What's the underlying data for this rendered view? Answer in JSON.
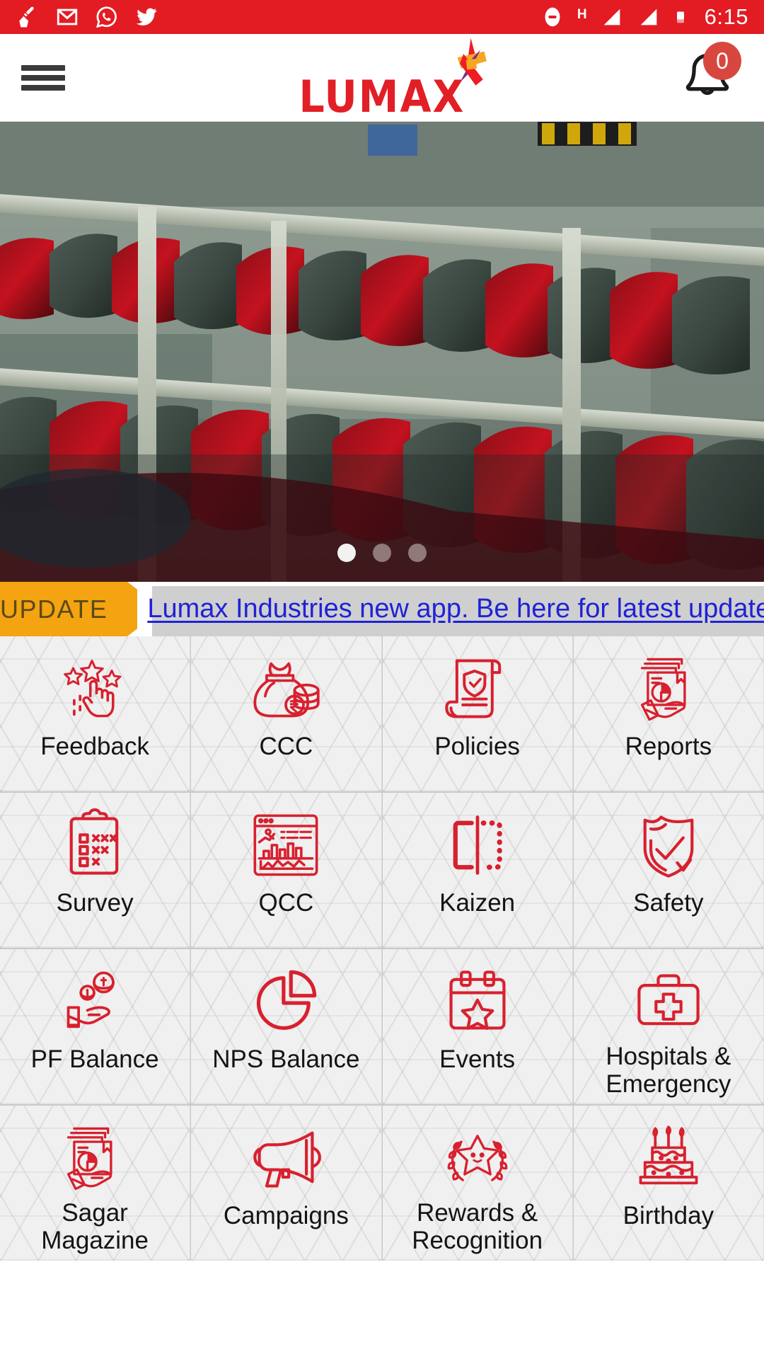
{
  "statusbar": {
    "time": "6:15",
    "network_type": "H",
    "left_icons": [
      "broom-cleaner-icon",
      "gmail-icon",
      "whatsapp-icon",
      "twitter-icon"
    ],
    "right_icons": [
      "do-not-disturb-icon",
      "signal-bars-icon",
      "signal-bars-2-icon",
      "battery-icon"
    ]
  },
  "header": {
    "menu_label": "menu",
    "brand_name": "LUMAX",
    "notification_count": "0"
  },
  "hero": {
    "caption": "",
    "slide_count": 3,
    "active_slide": 1
  },
  "ticker": {
    "tag_label": "UPDATE",
    "message": "Lumax Industries new app. Be here for latest updates."
  },
  "colors": {
    "brand_red": "#e21f26",
    "status_red": "#e31b23",
    "icon_red": "#d8202f",
    "update_orange": "#f4a311",
    "link_blue": "#1f22d6",
    "tile_bg": "#eff0ef",
    "ticker_grey": "#cfcfcf"
  },
  "grid": {
    "tiles": [
      {
        "label": "Feedback",
        "icon": "stars-hand-rating-icon"
      },
      {
        "label": "CCC",
        "icon": "money-bag-rupee-icon"
      },
      {
        "label": "Policies",
        "icon": "scroll-shield-check-icon"
      },
      {
        "label": "Reports",
        "icon": "documents-piechart-hand-icon"
      },
      {
        "label": "Survey",
        "icon": "clipboard-checklist-icon"
      },
      {
        "label": "QCC",
        "icon": "dashboard-charts-icon"
      },
      {
        "label": "Kaizen",
        "icon": "bracket-dotted-icon"
      },
      {
        "label": "Safety",
        "icon": "shield-check-icon"
      },
      {
        "label": "PF Balance",
        "icon": "hand-coins-icon"
      },
      {
        "label": "NPS Balance",
        "icon": "pie-chart-icon"
      },
      {
        "label": "Events",
        "icon": "calendar-star-icon"
      },
      {
        "label": "Hospitals & Emergency",
        "icon": "first-aid-kit-icon"
      },
      {
        "label": "Sagar Magazine",
        "icon": "documents-piechart-hand-icon"
      },
      {
        "label": "Campaigns",
        "icon": "megaphone-icon"
      },
      {
        "label": "Rewards & Recognition",
        "icon": "star-laurel-icon"
      },
      {
        "label": "Birthday",
        "icon": "birthday-cake-icon"
      }
    ]
  }
}
